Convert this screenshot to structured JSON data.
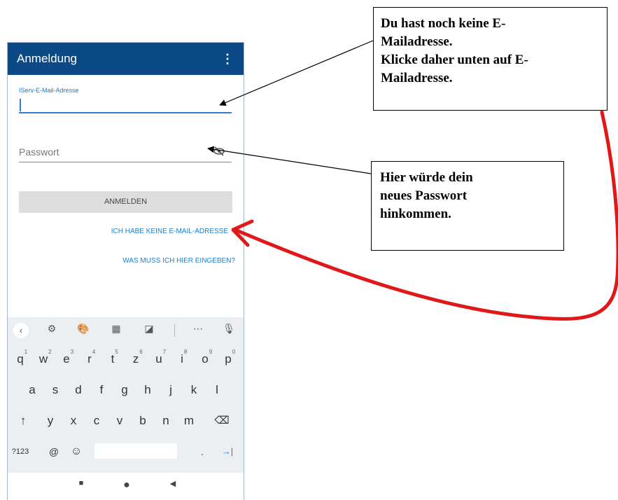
{
  "appbar": {
    "title": "Anmeldung",
    "menu": "⋮"
  },
  "form": {
    "email_label": "IServ-E-Mail-Adresse",
    "password_placeholder": "Passwort",
    "login_button": "ANMELDEN",
    "no_email_link": "ICH HABE KEINE E-MAIL-ADRESSE",
    "help_link": "WAS MUSS ICH HIER EINGEBEN?"
  },
  "keyboard": {
    "toolbar": [
      "‹",
      "⚙",
      "🎨",
      "▦",
      "◪",
      "⋯",
      "🎙"
    ],
    "row1": [
      "q",
      "w",
      "e",
      "r",
      "t",
      "z",
      "u",
      "i",
      "o",
      "p"
    ],
    "row1_digits": [
      "1",
      "2",
      "3",
      "4",
      "5",
      "6",
      "7",
      "8",
      "9",
      "0"
    ],
    "row2": [
      "a",
      "s",
      "d",
      "f",
      "g",
      "h",
      "j",
      "k",
      "l"
    ],
    "row3": [
      "↑",
      "y",
      "x",
      "c",
      "v",
      "b",
      "n",
      "m",
      "⌫"
    ],
    "row4_left": [
      "?123",
      "@",
      "☺"
    ],
    "row4_right": [
      ".",
      "→|"
    ]
  },
  "navbar": [
    "■",
    "●",
    "◀"
  ],
  "annotations": {
    "callout1_lines": [
      "Du hast noch keine E-",
      "Mailadresse.",
      "Klicke daher unten auf E-",
      "Mailadresse."
    ],
    "callout2_lines": [
      "Hier würde dein",
      "neues Passwort",
      "hinkommen."
    ]
  },
  "colors": {
    "appbar": "#0b4a86",
    "link": "#1e7fd0",
    "arrow_red": "#e01818"
  }
}
